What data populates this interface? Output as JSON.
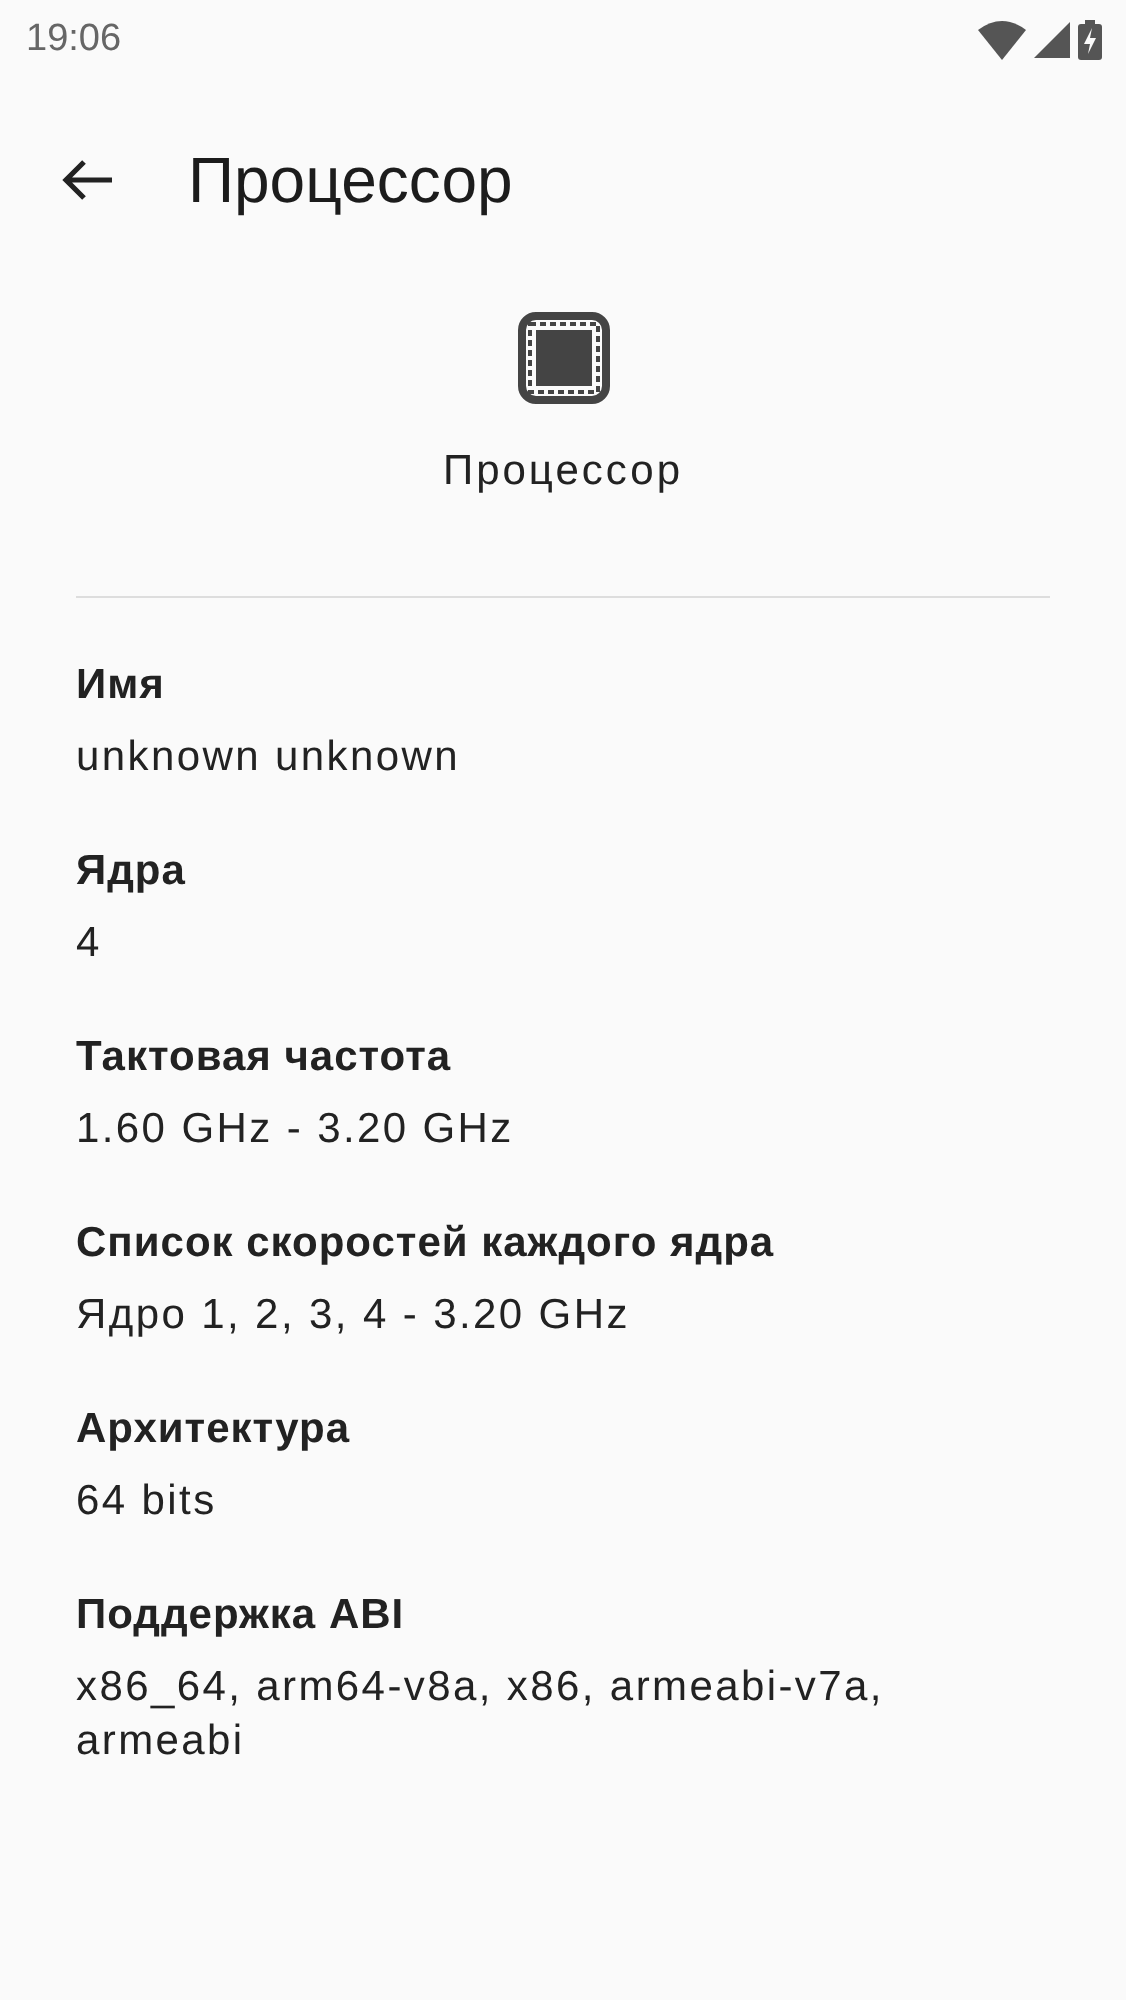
{
  "status_bar": {
    "time": "19:06"
  },
  "app_bar": {
    "title": "Процессор"
  },
  "header": {
    "label": "Процессор"
  },
  "items": [
    {
      "label": "Имя",
      "value": "unknown unknown"
    },
    {
      "label": "Ядра",
      "value": "4"
    },
    {
      "label": "Тактовая частота",
      "value": "1.60 GHz - 3.20 GHz"
    },
    {
      "label": "Список скоростей каждого ядра",
      "value": "Ядро 1, 2, 3, 4 - 3.20 GHz"
    },
    {
      "label": "Архитектура",
      "value": "64 bits"
    },
    {
      "label": "Поддержка ABI",
      "value": "x86_64, arm64-v8a, x86, armeabi-v7a, armeabi"
    }
  ]
}
